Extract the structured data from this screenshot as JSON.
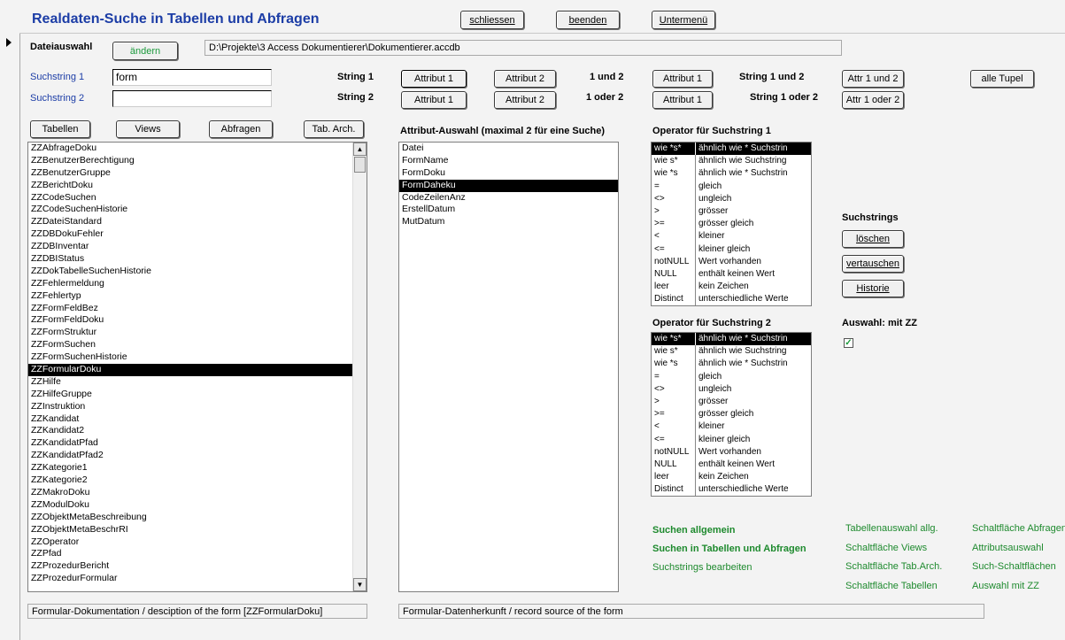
{
  "title": "Realdaten-Suche in Tabellen und Abfragen",
  "top_buttons": {
    "schliessen": "schliessen",
    "beenden": "beenden",
    "untermenu": "Untermenü"
  },
  "dateiauswahl": {
    "label": "Dateiauswahl",
    "button": "ändern",
    "path": "D:\\Projekte\\3 Access Dokumentierer\\Dokumentierer.accdb"
  },
  "suchstring1": {
    "label": "Suchstring 1",
    "value": "form"
  },
  "suchstring2": {
    "label": "Suchstring 2",
    "value": ""
  },
  "row1": {
    "string_label": "String 1",
    "attr1": "Attribut 1",
    "attr2": "Attribut 2",
    "und": "1 und 2",
    "attr1b": "Attribut 1",
    "string_und": "String 1 und 2",
    "attr_und": "Attr 1 und 2",
    "alle": "alle Tupel"
  },
  "row2": {
    "string_label": "String 2",
    "attr1": "Attribut 1",
    "attr2": "Attribut 2",
    "oder": "1 oder 2",
    "attr1b": "Attribut 1",
    "string_oder": "String 1 oder 2",
    "attr_oder": "Attr 1 oder 2"
  },
  "type_buttons": {
    "tabellen": "Tabellen",
    "views": "Views",
    "abfragen": "Abfragen",
    "tab_arch": "Tab. Arch."
  },
  "table_list": [
    "ZZAbfrageDoku",
    "ZZBenutzerBerechtigung",
    "ZZBenutzerGruppe",
    "ZZBerichtDoku",
    "ZZCodeSuchen",
    "ZZCodeSuchenHistorie",
    "ZZDateiStandard",
    "ZZDBDokuFehler",
    "ZZDBInventar",
    "ZZDBIStatus",
    "ZZDokTabelleSuchenHistorie",
    "ZZFehlermeldung",
    "ZZFehlertyp",
    "ZZFormFeldBez",
    "ZZFormFeldDoku",
    "ZZFormStruktur",
    "ZZFormSuchen",
    "ZZFormSuchenHistorie",
    "ZZFormularDoku",
    "ZZHilfe",
    "ZZHilfeGruppe",
    "ZZInstruktion",
    "ZZKandidat",
    "ZZKandidat2",
    "ZZKandidatPfad",
    "ZZKandidatPfad2",
    "ZZKategorie1",
    "ZZKategorie2",
    "ZZMakroDoku",
    "ZZModulDoku",
    "ZZObjektMetaBeschreibung",
    "ZZObjektMetaBeschrRI",
    "ZZOperator",
    "ZZPfad",
    "ZZProzedurBericht",
    "ZZProzedurFormular"
  ],
  "table_selected": "ZZFormularDoku",
  "attr_heading": "Attribut-Auswahl (maximal 2 für eine Suche)",
  "attr_list": [
    "Datei",
    "FormName",
    "FormDoku",
    "FormDaheku",
    "CodeZeilenAnz",
    "ErstellDatum",
    "MutDatum"
  ],
  "attr_selected": "FormDaheku",
  "op1_heading": "Operator für Suchstring 1",
  "op2_heading": "Operator für Suchstring 2",
  "operators": [
    [
      "wie *s*",
      "ähnlich wie * Suchstrin"
    ],
    [
      "wie s*",
      "ähnlich wie Suchstring"
    ],
    [
      "wie *s",
      "ähnlich wie * Suchstrin"
    ],
    [
      "=",
      "gleich"
    ],
    [
      "<>",
      "ungleich"
    ],
    [
      ">",
      "grösser"
    ],
    [
      ">=",
      "grösser gleich"
    ],
    [
      "<",
      "kleiner"
    ],
    [
      "<=",
      "kleiner gleich"
    ],
    [
      "notNULL",
      "Wert vorhanden"
    ],
    [
      "NULL",
      "enthält keinen Wert"
    ],
    [
      "leer",
      "kein Zeichen"
    ],
    [
      "Distinct",
      "unterschiedliche Werte"
    ]
  ],
  "suchstrings": {
    "heading": "Suchstrings",
    "loeschen": "löschen",
    "vertauschen": "vertauschen",
    "historie": "Historie"
  },
  "auswahl_zz": {
    "label": "Auswahl: mit ZZ",
    "checked": true
  },
  "help": {
    "col1": [
      "Suchen allgemein",
      "Suchen in Tabellen und Abfragen",
      "Suchstrings bearbeiten"
    ],
    "col2": [
      "Tabellenauswahl allg.",
      "Schaltfläche Views",
      "Schaltfläche Tab.Arch.",
      "Schaltfläche Tabellen"
    ],
    "col3": [
      "Schaltfläche Abfragen",
      "Attributsauswahl",
      "Such-Schaltflächen",
      "Auswahl mit ZZ"
    ]
  },
  "status_left": "Formular-Dokumentation / desciption of the form  [ZZFormularDoku]",
  "status_right": "Formular-Datenherkunft / record source of the form",
  "colors": {
    "title": "#1c3da6",
    "green": "#1e8a2e",
    "selected": "#000000"
  }
}
